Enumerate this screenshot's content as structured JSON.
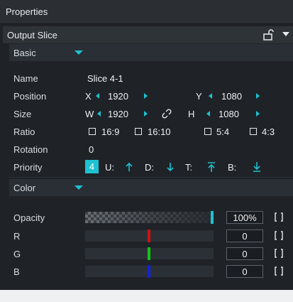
{
  "window": {
    "title": "Properties"
  },
  "slice": {
    "title": "Output Slice"
  },
  "basic": {
    "section_label": "Basic",
    "name": {
      "label": "Name",
      "value": "Slice 4-1"
    },
    "position": {
      "label": "Position",
      "x_label": "X",
      "x_value": "1920",
      "y_label": "Y",
      "y_value": "1080"
    },
    "size": {
      "label": "Size",
      "w_label": "W",
      "w_value": "1920",
      "h_label": "H",
      "h_value": "1080"
    },
    "ratio": {
      "label": "Ratio",
      "options": [
        "16:9",
        "16:10",
        "5:4",
        "4:3"
      ]
    },
    "rotation": {
      "label": "Rotation",
      "value": "0"
    },
    "priority": {
      "label": "Priority",
      "value": "4",
      "u_label": "U:",
      "d_label": "D:",
      "t_label": "T:",
      "b_label": "B:"
    }
  },
  "color": {
    "section_label": "Color",
    "opacity": {
      "label": "Opacity",
      "value": "100%",
      "level": 1.0
    },
    "r": {
      "label": "R",
      "value": "0",
      "level": 0.0,
      "color": "#d01010"
    },
    "g": {
      "label": "G",
      "value": "0",
      "level": 0.0,
      "color": "#15c415"
    },
    "b": {
      "label": "B",
      "value": "0",
      "level": 0.0,
      "color": "#1122dd"
    }
  },
  "theme": {
    "accent": "#1ec1d1",
    "panel_bg": "#1f2328"
  }
}
